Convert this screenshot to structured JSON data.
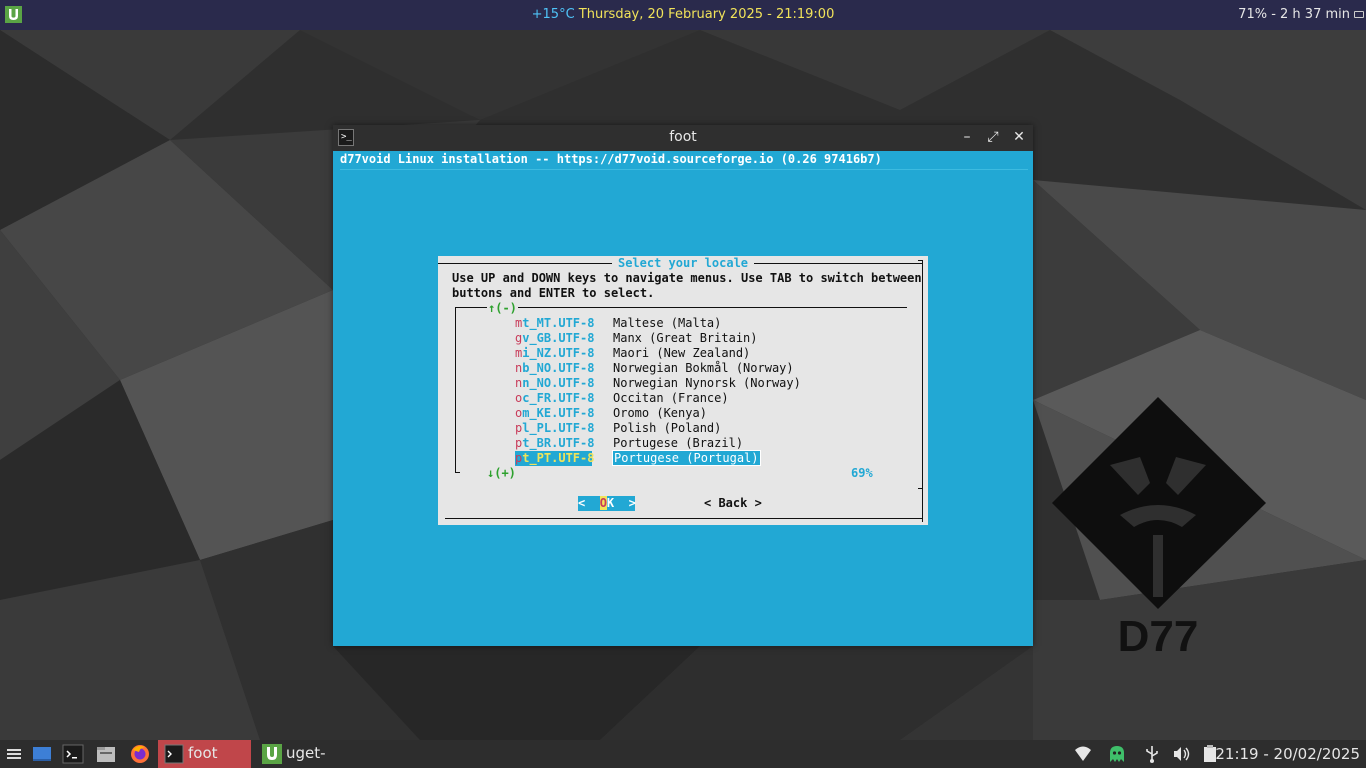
{
  "topbar": {
    "temperature": "+15°C",
    "datetime": "Thursday, 20 February 2025 - 21:19:00",
    "battery": "71% - 2 h 37 min",
    "launcher_icon": "uget-icon"
  },
  "window": {
    "title": "foot",
    "icon": "terminal-icon",
    "buttons": [
      "minimize-icon",
      "maximize-icon",
      "close-icon"
    ],
    "header": "d77void Linux installation -- https://d77void.sourceforge.io (0.26 97416b7)"
  },
  "dialog": {
    "title": "Select your locale",
    "instructions": "Use UP and DOWN keys to navigate menus. Use TAB to switch between\nbuttons and ENTER to select.",
    "scroll_up": "↑(-)",
    "scroll_down": "↓(+)",
    "percent": "69%",
    "items": [
      {
        "hotkey": "m",
        "code_rest": "t_MT.UTF-8",
        "desc": "Maltese (Malta)"
      },
      {
        "hotkey": "g",
        "code_rest": "v_GB.UTF-8",
        "desc": "Manx (Great Britain)"
      },
      {
        "hotkey": "m",
        "code_rest": "i_NZ.UTF-8",
        "desc": "Maori (New Zealand)"
      },
      {
        "hotkey": "n",
        "code_rest": "b_NO.UTF-8",
        "desc": "Norwegian Bokmål (Norway)"
      },
      {
        "hotkey": "n",
        "code_rest": "n_NO.UTF-8",
        "desc": "Norwegian Nynorsk (Norway)"
      },
      {
        "hotkey": "o",
        "code_rest": "c_FR.UTF-8",
        "desc": "Occitan (France)"
      },
      {
        "hotkey": "o",
        "code_rest": "m_KE.UTF-8",
        "desc": "Oromo (Kenya)"
      },
      {
        "hotkey": "p",
        "code_rest": "l_PL.UTF-8",
        "desc": "Polish (Poland)"
      },
      {
        "hotkey": "p",
        "code_rest": "t_BR.UTF-8",
        "desc": "Portugese (Brazil)"
      },
      {
        "hotkey": "p",
        "code_rest": "t_PT.UTF-8",
        "desc": "Portugese (Portugal)"
      }
    ],
    "selected_index": 9,
    "ok": {
      "left": "<  ",
      "hotkey": "O",
      "rest": "K  >"
    },
    "back_label": "< Back >"
  },
  "logo": {
    "text": "D77"
  },
  "taskbar": {
    "tasks": [
      {
        "label": "foot",
        "icon": "terminal-icon",
        "active": true
      },
      {
        "label": "uget-gtk",
        "icon": "uget-icon",
        "active": false
      }
    ],
    "quicklaunch": [
      "menu-icon",
      "desktop-icon",
      "terminal-icon",
      "file-manager-icon",
      "firefox-icon"
    ],
    "tray": [
      "wifi-icon",
      "ghost-icon",
      "usb-icon",
      "volume-icon",
      "clipboard-icon"
    ],
    "clock": "21:19 - 20/02/2025"
  }
}
